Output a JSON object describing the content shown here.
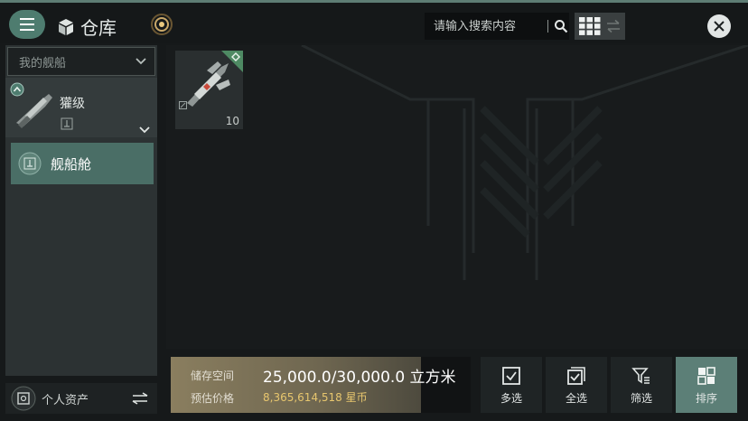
{
  "header": {
    "title": "仓库",
    "search_placeholder": "请输入搜索内容"
  },
  "sidebar": {
    "dropdown_label": "我的舰船",
    "ship_name": "獾级",
    "hangar_label": "舰船舱",
    "assets_label": "个人资产"
  },
  "items": [
    {
      "count": "10"
    }
  ],
  "storage": {
    "capacity_label": "储存空间",
    "capacity_value": "25,000.0/30,000.0 立方米",
    "capacity_fraction": 0.833,
    "price_label": "预估价格",
    "price_value": "8,365,614,518 星币"
  },
  "actions": {
    "multi_select": "多选",
    "select_all": "全选",
    "filter": "筛选",
    "sort": "排序"
  },
  "colors": {
    "accent": "#4e7c6f",
    "active_action": "#5c7f77",
    "price": "#e7c66e"
  }
}
